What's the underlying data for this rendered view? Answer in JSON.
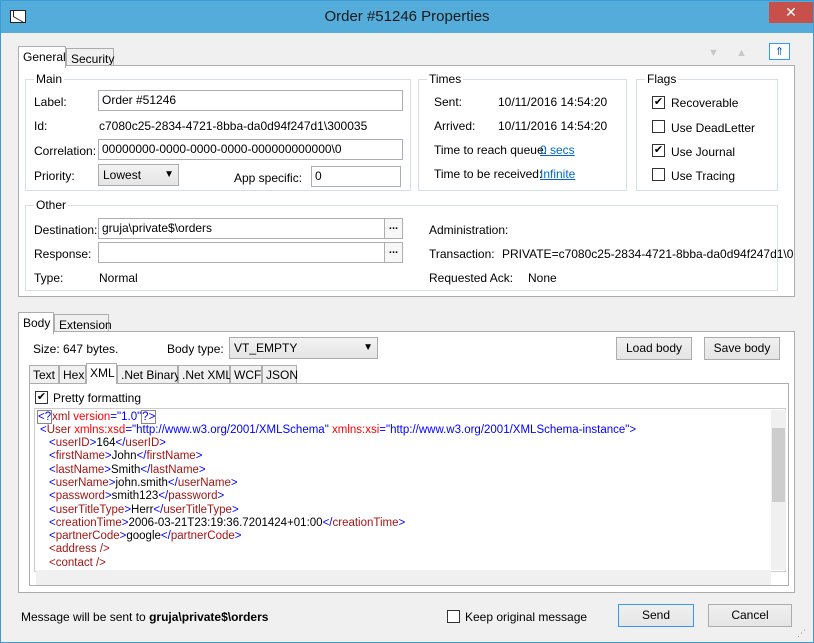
{
  "window": {
    "title": "Order #51246 Properties",
    "close_glyph": "✕"
  },
  "top_tabs": [
    "General",
    "Security"
  ],
  "main": {
    "title": "Main",
    "label_label": "Label:",
    "label_value": "Order #51246",
    "id_label": "Id:",
    "id_value": "c7080c25-2834-4721-8bba-da0d94f247d1\\300035",
    "correlation_label": "Correlation:",
    "correlation_value": "00000000-0000-0000-0000-000000000000\\0",
    "priority_label": "Priority:",
    "priority_value": "Lowest",
    "app_specific_label": "App specific:",
    "app_specific_value": "0"
  },
  "times": {
    "title": "Times",
    "sent_label": "Sent:",
    "sent_value": "10/11/2016 14:54:20",
    "arrived_label": "Arrived:",
    "arrived_value": "10/11/2016 14:54:20",
    "ttrq_label": "Time to reach queue:",
    "ttrq_value": "0 secs",
    "ttbr_label": "Time to be received:",
    "ttbr_value": "Infinite"
  },
  "flags": {
    "title": "Flags",
    "items": [
      {
        "label": "Recoverable",
        "checked": true
      },
      {
        "label": "Use DeadLetter",
        "checked": false
      },
      {
        "label": "Use Journal",
        "checked": true
      },
      {
        "label": "Use Tracing",
        "checked": false
      }
    ]
  },
  "other": {
    "title": "Other",
    "destination_label": "Destination:",
    "destination_value": "gruja\\private$\\orders",
    "response_label": "Response:",
    "response_value": "",
    "type_label": "Type:",
    "type_value": "Normal",
    "administration_label": "Administration:",
    "transaction_label": "Transaction:",
    "transaction_value": "PRIVATE=c7080c25-2834-4721-8bba-da0d94f247d1\\0",
    "requested_ack_label": "Requested Ack:",
    "requested_ack_value": "None",
    "ellipsis": "..."
  },
  "body_tabs": [
    "Body",
    "Extension"
  ],
  "body": {
    "size_label": "Size: 647 bytes.",
    "body_type_label": "Body type:",
    "body_type_value": "VT_EMPTY",
    "load_body": "Load body",
    "save_body": "Save body",
    "format_tabs": [
      "Text",
      "Hex",
      "XML",
      ".Net Binary",
      ".Net XML",
      "WCF",
      "JSON"
    ],
    "pretty_label": "Pretty formatting",
    "pretty_checked": true
  },
  "xml": {
    "decl": {
      "open": "<?",
      "name": "xml",
      "attr": "version",
      "eq": "=",
      "val": "\"1.0\"",
      "close": "?>"
    },
    "user_open": {
      "lt": "<",
      "name": "User",
      "a1": "xmlns:xsd",
      "v1": "\"http://www.w3.org/2001/XMLSchema\"",
      "a2": "xmlns:xsi",
      "v2": "\"http://www.w3.org/2001/XMLSchema-instance\"",
      "gt": ">"
    },
    "children": [
      {
        "tag": "userID",
        "text": "164"
      },
      {
        "tag": "firstName",
        "text": "John"
      },
      {
        "tag": "lastName",
        "text": "Smith"
      },
      {
        "tag": "userName",
        "text": "john.smith"
      },
      {
        "tag": "password",
        "text": "smith123"
      },
      {
        "tag": "userTitleType",
        "text": "Herr"
      },
      {
        "tag": "creationTime",
        "text": "2006-03-21T23:19:36.7201424+01:00"
      },
      {
        "tag": "partnerCode",
        "text": "google"
      }
    ],
    "empty_tags": [
      "<address />",
      "<contact />"
    ]
  },
  "footer": {
    "prefix": "Message will be sent to ",
    "destination": "gruja\\private$\\orders",
    "keep_original_label": "Keep original message",
    "send": "Send",
    "cancel": "Cancel"
  },
  "colors": {
    "titlebar": "#53acd9",
    "close": "#c7504b",
    "xml_tag": "#a31515",
    "xml_attr": "#ff0000",
    "xml_value": "#0000ff"
  }
}
